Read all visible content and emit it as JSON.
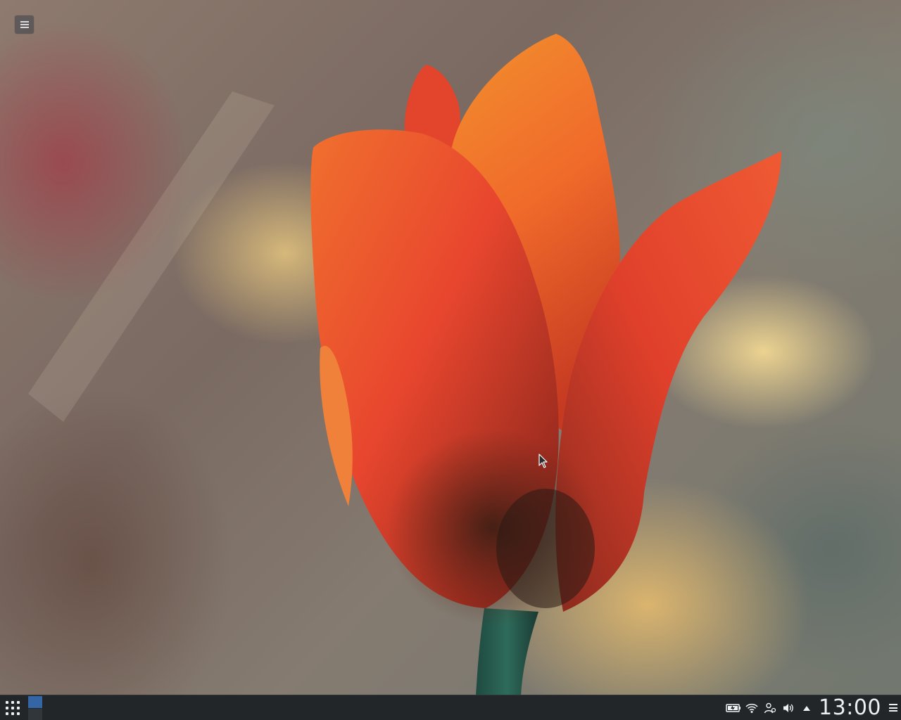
{
  "desktop": {
    "wallpaper": "red-tulip-photo",
    "toolbox_icon": "hamburger-menu-icon"
  },
  "panel": {
    "launcher_icon": "app-grid-icon",
    "pager": {
      "desktop_count": 2,
      "active_desktop": 1
    },
    "tray": {
      "icons": [
        "battery-icon",
        "wifi-icon",
        "user-switch-icon",
        "volume-icon",
        "expand-tray-icon"
      ]
    },
    "clock": "13:00",
    "options_icon": "panel-options-icon"
  },
  "colors": {
    "panel_bg": "#232629",
    "pager_active": "#3465a4",
    "pager_inactive": "#31363b",
    "text": "#eff0f1"
  }
}
